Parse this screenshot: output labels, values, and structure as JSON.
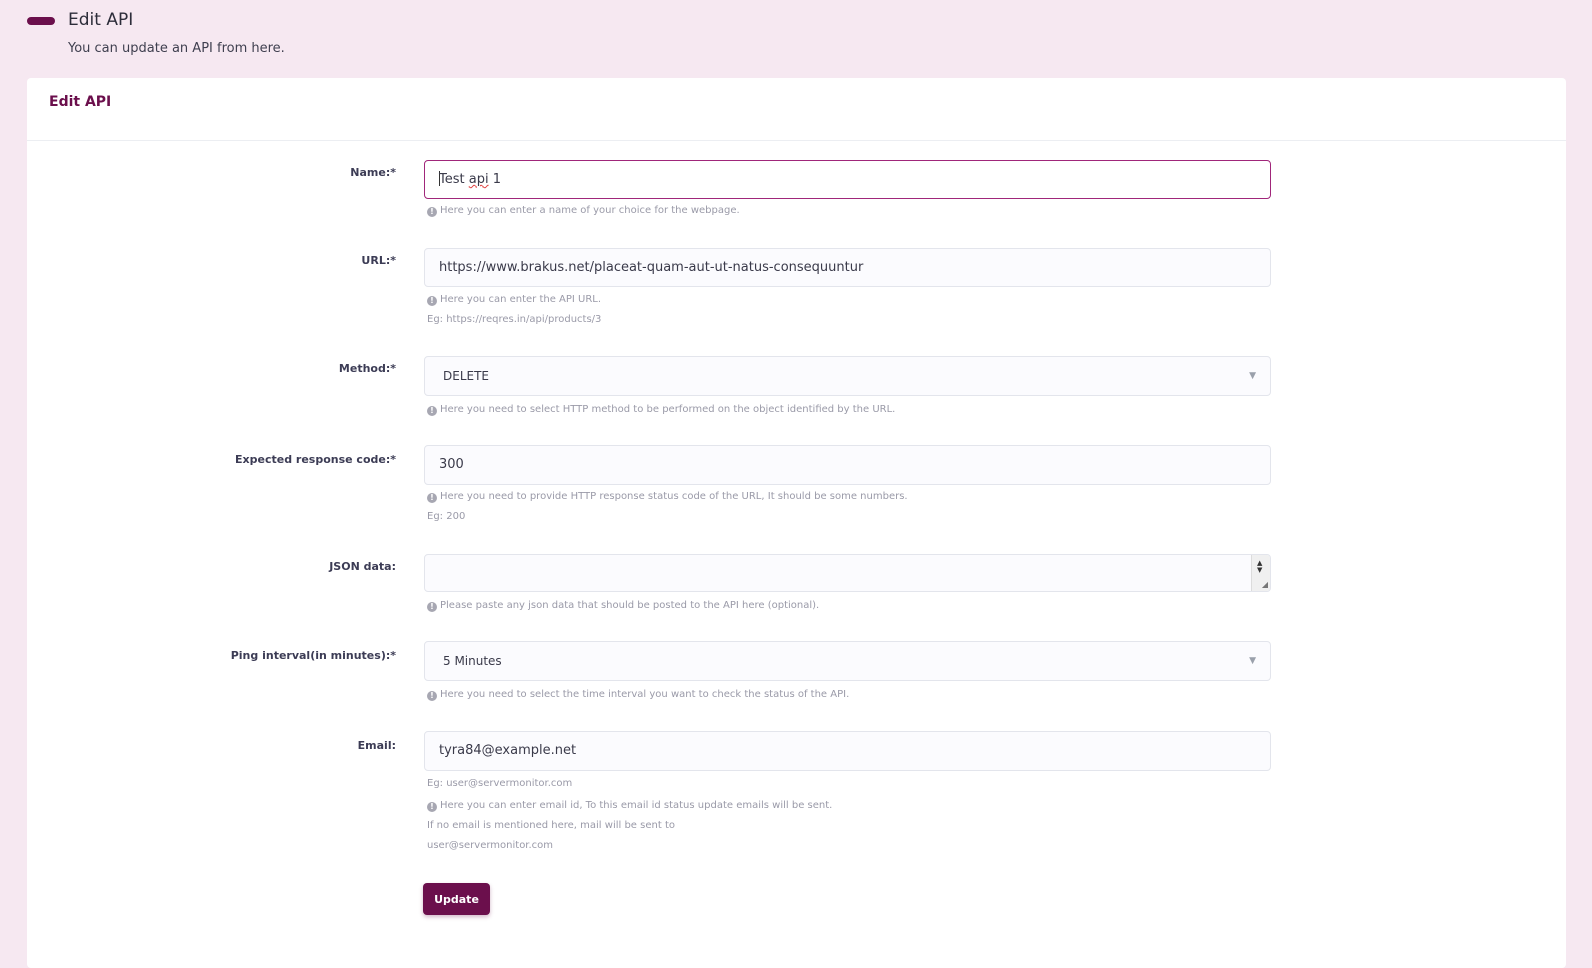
{
  "header": {
    "title": "Edit API",
    "subtitle": "You can update an API from here."
  },
  "card": {
    "title": "Edit API"
  },
  "form": {
    "name": {
      "label": "Name:*",
      "value_first": "Test",
      "value_flagged": "api",
      "value_last": "1",
      "help": "Here you can enter a name of your choice for the webpage."
    },
    "url": {
      "label": "URL:*",
      "value": "https://www.brakus.net/placeat-quam-aut-ut-natus-consequuntur",
      "help": "Here you can enter the API URL.",
      "example": "Eg: https://reqres.in/api/products/3"
    },
    "method": {
      "label": "Method:*",
      "value": "DELETE",
      "help": "Here you need to select HTTP method to be performed on the object identified by the URL."
    },
    "response_code": {
      "label": "Expected response code:*",
      "value": "300",
      "help": "Here you need to provide HTTP response status code of the URL, It should be some numbers.",
      "example": "Eg: 200"
    },
    "json_data": {
      "label": "JSON data:",
      "value": "",
      "help": "Please paste any json data that should be posted to the API here (optional)."
    },
    "ping_interval": {
      "label": "Ping interval(in minutes):*",
      "value": "5 Minutes",
      "help": "Here you need to select the time interval you want to check the status of the API."
    },
    "email": {
      "label": "Email:",
      "value": "tyra84@example.net",
      "example": "Eg: user@servermonitor.com",
      "help": "Here you can enter email id, To this email id status update emails will be sent.",
      "help_line2": "If no email is mentioned here, mail will be sent to",
      "help_line3": "user@servermonitor.com"
    },
    "submit_label": "Update"
  },
  "icons": {
    "info": "info-circle-icon",
    "select_arrow": "chevron-down-icon"
  },
  "colors": {
    "accent": "#6b0f4c",
    "focus_border": "#a0267a",
    "page_background": "#f6e8f1"
  }
}
